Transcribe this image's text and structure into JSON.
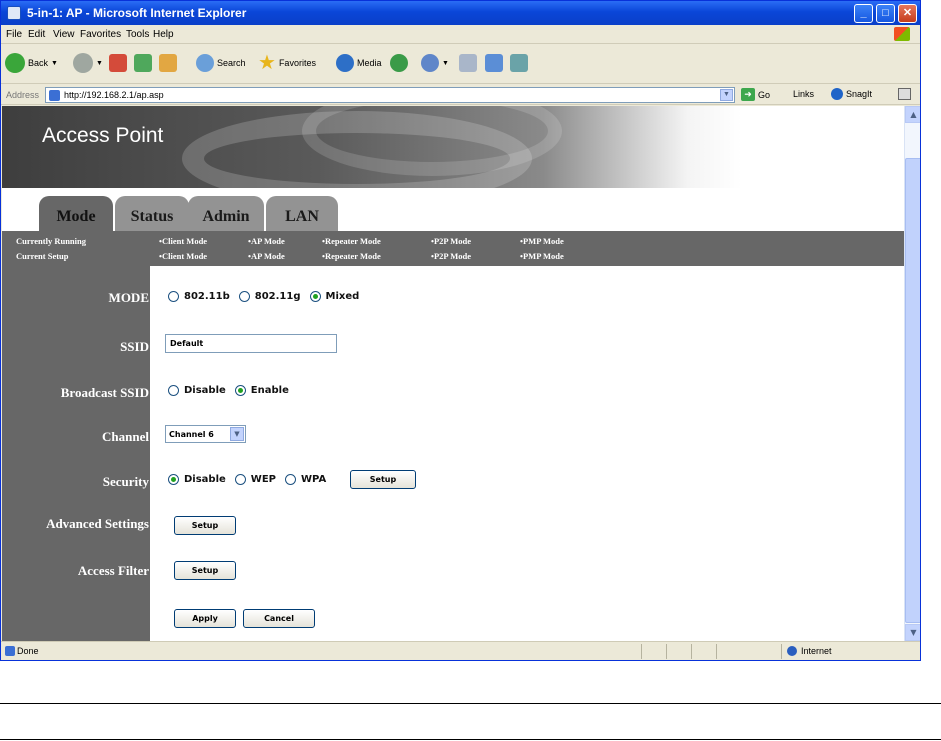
{
  "window": {
    "title": "5-in-1: AP - Microsoft Internet Explorer",
    "minimize": "_",
    "maximize": "□",
    "close": "✕"
  },
  "menu": [
    "File",
    "Edit",
    "View",
    "Favorites",
    "Tools",
    "Help"
  ],
  "toolbar": {
    "back": "Back",
    "search": "Search",
    "favorites": "Favorites",
    "media": "Media"
  },
  "address": {
    "label": "Address",
    "url": "http://192.168.2.1/ap.asp",
    "go": "Go",
    "links": "Links",
    "snagit": "SnagIt"
  },
  "page": {
    "banner_title": "Access Point",
    "tabs": [
      "Mode",
      "Status",
      "Admin",
      "LAN"
    ],
    "modes_bar": {
      "row_labels": [
        "Currently Running",
        "Current Setup"
      ],
      "modes": [
        "•Client Mode",
        "•AP Mode",
        "•Repeater Mode",
        "•P2P Mode",
        "•PMP Mode"
      ]
    },
    "form": {
      "mode": {
        "label": "MODE",
        "options": [
          "802.11b",
          "802.11g",
          "Mixed"
        ],
        "selected": "Mixed"
      },
      "ssid": {
        "label": "SSID",
        "value": "Default"
      },
      "broadcast": {
        "label": "Broadcast SSID",
        "options": [
          "Disable",
          "Enable"
        ],
        "selected": "Enable"
      },
      "channel": {
        "label": "Channel",
        "value": "Channel 6"
      },
      "security": {
        "label": "Security",
        "options": [
          "Disable",
          "WEP",
          "WPA"
        ],
        "selected": "Disable",
        "setup": "Setup"
      },
      "advanced": {
        "label": "Advanced Settings",
        "setup": "Setup"
      },
      "access_filter": {
        "label": "Access Filter",
        "setup": "Setup"
      },
      "apply": "Apply",
      "cancel": "Cancel"
    }
  },
  "status": {
    "text": "Done",
    "zone": "Internet"
  },
  "colors": {
    "titlebar": "#0a46d8",
    "nav_gray": "#676767",
    "tab_gray": "#939393",
    "radio_dot": "#21a121"
  }
}
